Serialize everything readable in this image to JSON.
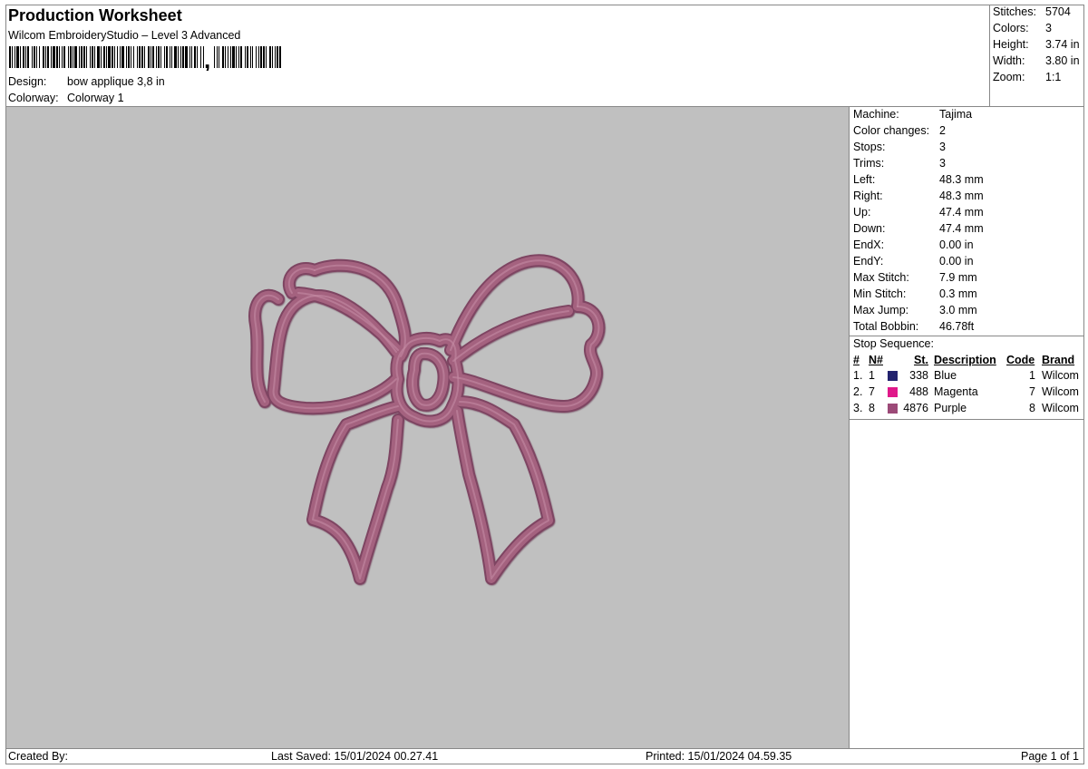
{
  "header": {
    "title": "Production Worksheet",
    "subtitle": "Wilcom EmbroideryStudio – Level 3 Advanced",
    "design_label": "Design:",
    "design_value": "bow applique 3,8 in",
    "colorway_label": "Colorway:",
    "colorway_value": "Colorway 1"
  },
  "summary": [
    {
      "label": "Stitches:",
      "value": "5704"
    },
    {
      "label": "Colors:",
      "value": "3"
    },
    {
      "label": "Height:",
      "value": "3.74 in"
    },
    {
      "label": "Width:",
      "value": "3.80 in"
    },
    {
      "label": "Zoom:",
      "value": "1:1"
    }
  ],
  "stats": [
    {
      "label": "Machine:",
      "value": "Tajima"
    },
    {
      "label": "Color changes:",
      "value": "2"
    },
    {
      "label": "Stops:",
      "value": "3"
    },
    {
      "label": "Trims:",
      "value": "3"
    },
    {
      "label": "Left:",
      "value": "48.3 mm"
    },
    {
      "label": "Right:",
      "value": "48.3 mm"
    },
    {
      "label": "Up:",
      "value": "47.4 mm"
    },
    {
      "label": "Down:",
      "value": "47.4 mm"
    },
    {
      "label": "EndX:",
      "value": "0.00 in"
    },
    {
      "label": "EndY:",
      "value": "0.00 in"
    },
    {
      "label": "Max Stitch:",
      "value": "7.9 mm"
    },
    {
      "label": "Min Stitch:",
      "value": "0.3 mm"
    },
    {
      "label": "Max Jump:",
      "value": "3.0 mm"
    },
    {
      "label": "Total Bobbin:",
      "value": "46.78ft"
    }
  ],
  "stop_sequence": {
    "title": "Stop Sequence:",
    "headers": {
      "num": "#",
      "n": "N#",
      "st": "St.",
      "desc": "Description",
      "code": "Code",
      "brand": "Brand"
    },
    "rows": [
      {
        "num": "1.",
        "n": "1",
        "color": "#22226e",
        "st": "338",
        "desc": "Blue",
        "code": "1",
        "brand": "Wilcom"
      },
      {
        "num": "2.",
        "n": "7",
        "color": "#e0188a",
        "st": "488",
        "desc": "Magenta",
        "code": "7",
        "brand": "Wilcom"
      },
      {
        "num": "3.",
        "n": "8",
        "color": "#9c4a78",
        "st": "4876",
        "desc": "Purple",
        "code": "8",
        "brand": "Wilcom"
      }
    ]
  },
  "footer": {
    "created_by": "Created By:",
    "last_saved": "Last Saved: 15/01/2024 00.27.41",
    "printed": "Printed: 15/01/2024 04.59.35",
    "page": "Page 1 of 1"
  },
  "canvas": {
    "background": "#c0c0c0",
    "stitch_color": "#a4627f",
    "stitch_dark": "#7e4462",
    "motif": "bow-outline"
  }
}
